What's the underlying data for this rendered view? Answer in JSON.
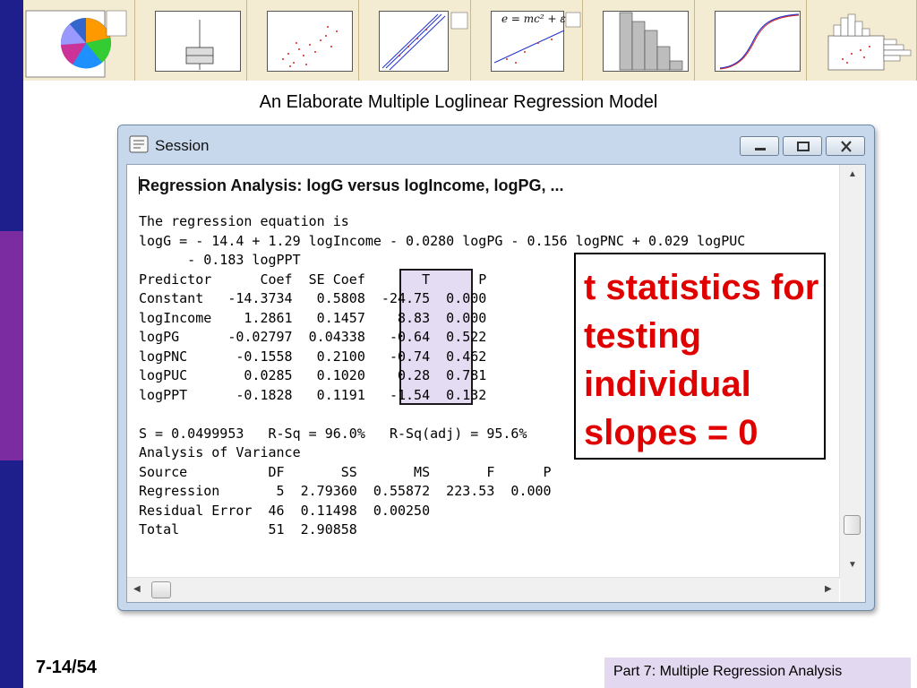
{
  "colors": {
    "left_bar_top": "#1e1e8c",
    "left_bar_mid": "#7a2ca0",
    "accent_red": "#e00000",
    "footer_bg": "#e2d8f0",
    "window_frame": "#c7d8ec",
    "t_column_highlight": "#e4dcf2"
  },
  "thumbnails": [
    {
      "icon": "pie-chart-thumbnail"
    },
    {
      "icon": "boxplot-thumbnail"
    },
    {
      "icon": "scatterplot-thumbnail"
    },
    {
      "icon": "probability-plot-thumbnail"
    },
    {
      "icon": "fitted-line-thumbnail",
      "equation": "e = mc² + ε"
    },
    {
      "icon": "histogram-thumbnail"
    },
    {
      "icon": "empirical-cdf-thumbnail"
    },
    {
      "icon": "marginal-plot-thumbnail"
    }
  ],
  "slide": {
    "title": "An Elaborate Multiple Loglinear Regression Model",
    "number": "7-14/54"
  },
  "window": {
    "title": "Session",
    "icon": "session-window-icon"
  },
  "session": {
    "heading": "Regression Analysis: logG versus logIncome, logPG, ...",
    "lines": [
      "The regression equation is",
      "logG = - 14.4 + 1.29 logIncome - 0.0280 logPG - 0.156 logPNC + 0.029 logPUC",
      "      - 0.183 logPPT",
      "Predictor      Coef  SE Coef       T      P",
      "Constant   -14.3734   0.5808  -24.75  0.000",
      "logIncome    1.2861   0.1457    8.83  0.000",
      "logPG      -0.02797  0.04338   -0.64  0.522",
      "logPNC      -0.1558   0.2100   -0.74  0.462",
      "logPUC       0.0285   0.1020    0.28  0.781",
      "logPPT      -0.1828   0.1191   -1.54  0.132",
      "",
      "S = 0.0499953   R-Sq = 96.0%   R-Sq(adj) = 95.6%",
      "Analysis of Variance",
      "Source          DF       SS       MS       F      P",
      "Regression       5  2.79360  0.55872  223.53  0.000",
      "Residual Error  46  0.11498  0.00250",
      "Total           51  2.90858"
    ]
  },
  "callout": {
    "text": "t statistics for testing individual slopes = 0"
  },
  "footer": {
    "text": "Part 7: Multiple Regression Analysis"
  }
}
